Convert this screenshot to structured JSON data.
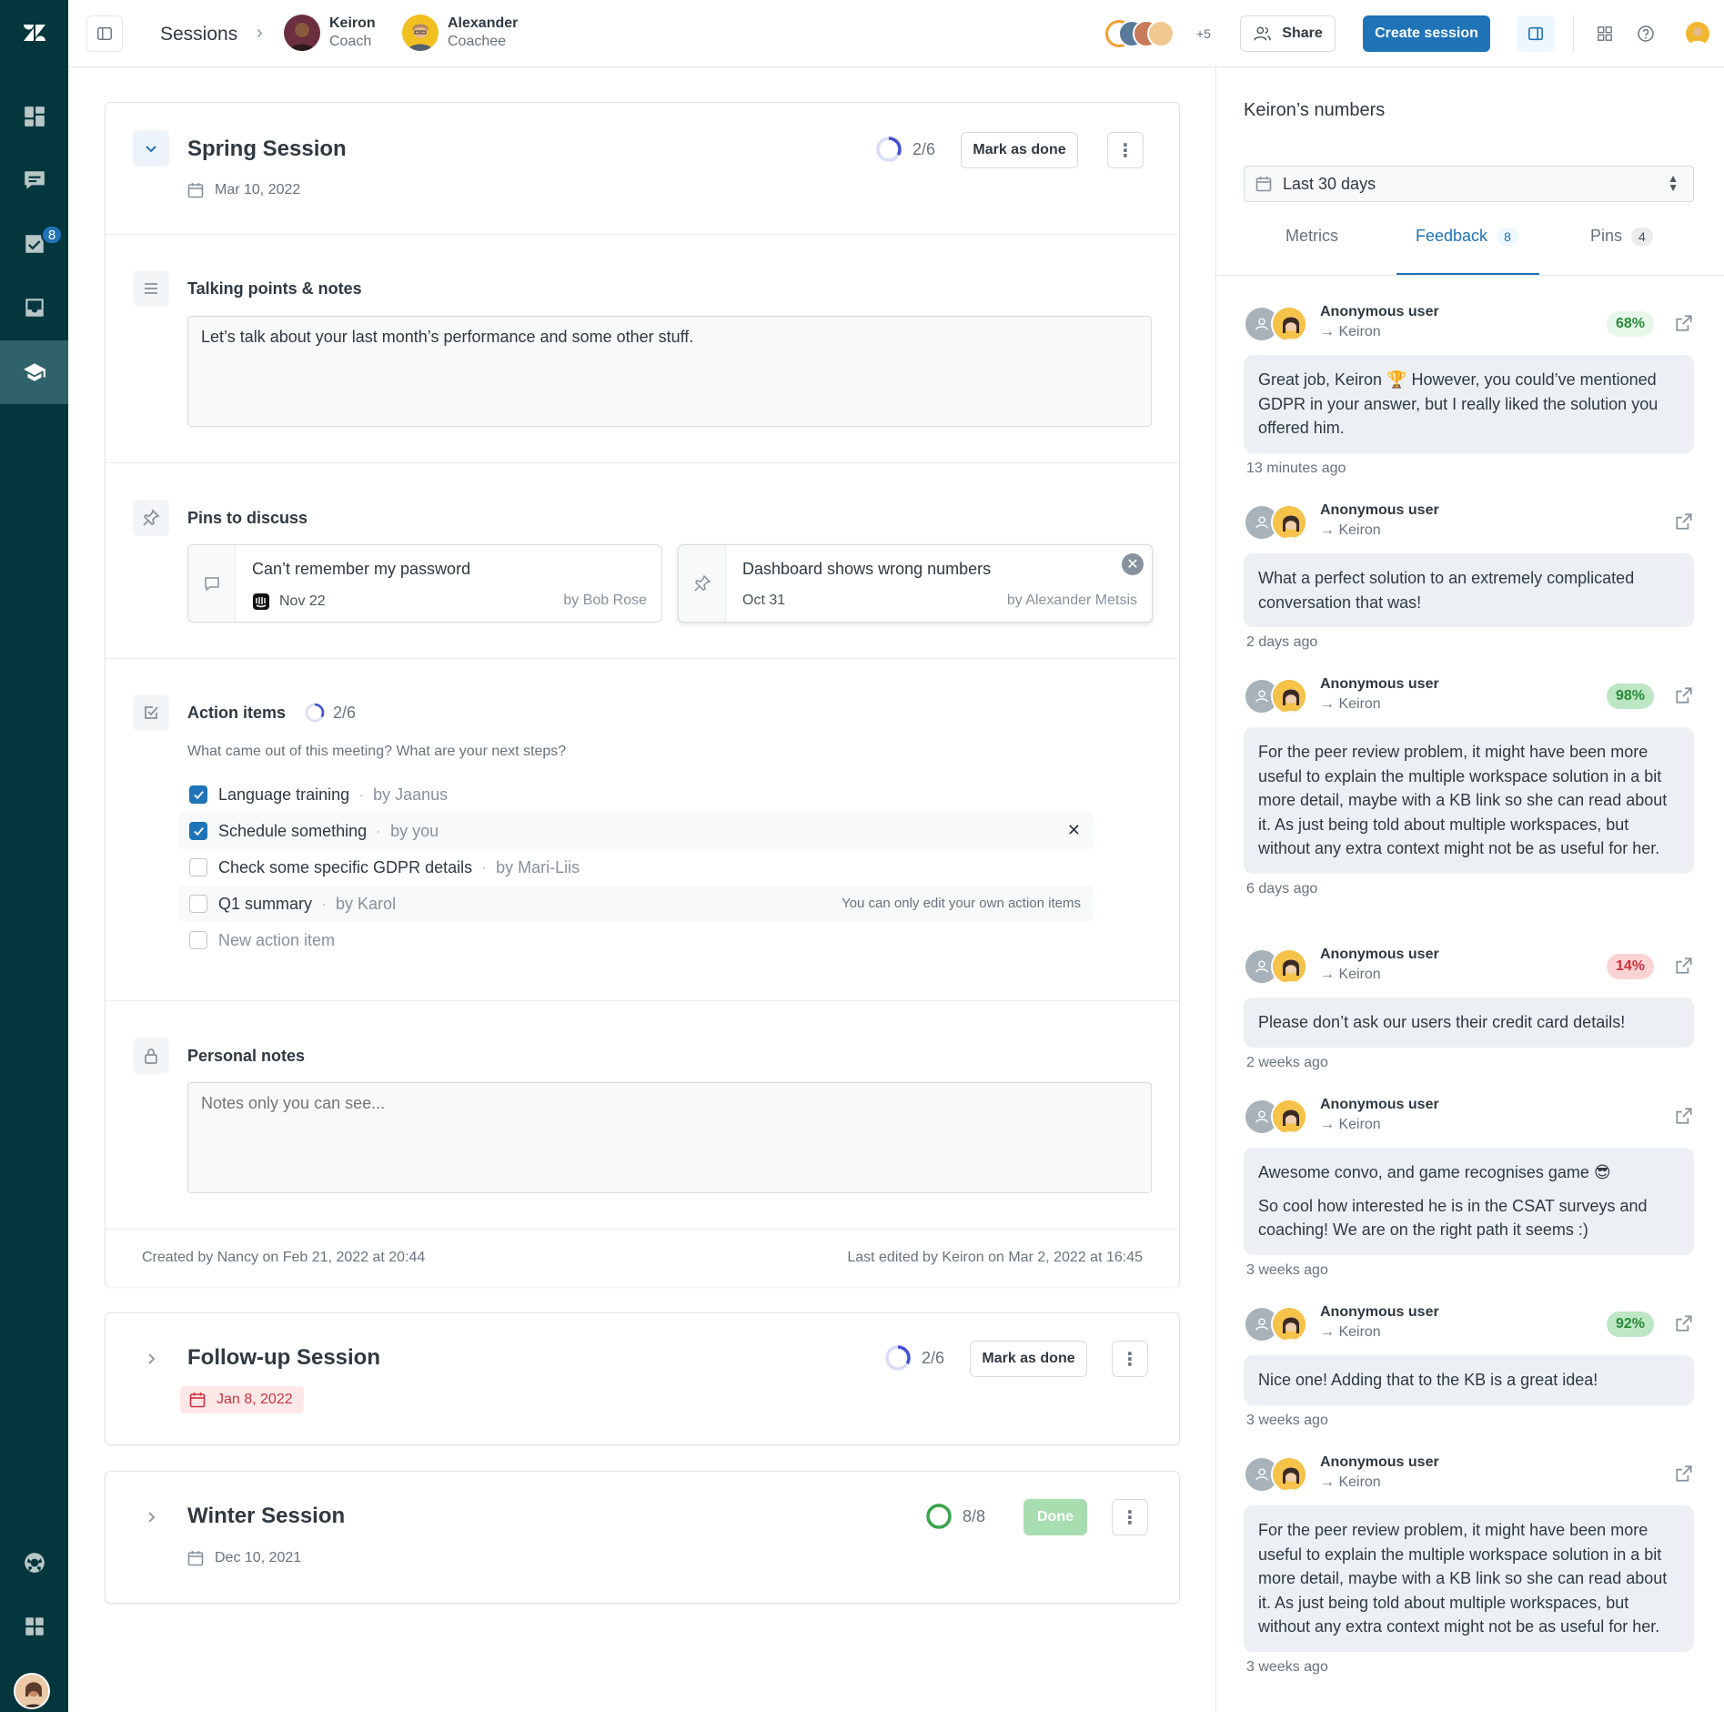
{
  "nav": {
    "tasks_badge": "8"
  },
  "header": {
    "breadcrumb": "Sessions",
    "coach": {
      "name": "Keiron",
      "role": "Coach"
    },
    "coachee": {
      "name": "Alexander",
      "role": "Coachee"
    },
    "participants_more": "+5",
    "share_label": "Share",
    "create_label": "Create session"
  },
  "sessions": {
    "spring": {
      "title": "Spring Session",
      "date": "Mar 10, 2022",
      "progress": "2/6",
      "progress_fraction": 0.333,
      "mark_done_label": "Mark as done",
      "talking_points_title": "Talking points & notes",
      "talking_points_text": "Let’s talk about your last month’s performance and some other stuff.",
      "pins_title": "Pins to discuss",
      "pins": [
        {
          "title": "Can’t remember my password",
          "date": "Nov 22",
          "by": "by Bob Rose"
        },
        {
          "title": "Dashboard shows wrong numbers",
          "date": "Oct 31",
          "by": "by Alexander Metsis"
        }
      ],
      "action_title": "Action items",
      "action_progress": "2/6",
      "action_hint": "What came out of this meeting? What are your next steps?",
      "actions": [
        {
          "text": "Language training",
          "by": "by Jaanus",
          "checked": true
        },
        {
          "text": "Schedule something",
          "by": "by you",
          "checked": true
        },
        {
          "text": "Check some specific GDPR details",
          "by": "by Mari-Liis",
          "checked": false
        },
        {
          "text": "Q1 summary",
          "by": "by Karol",
          "checked": false,
          "note": "You can only edit your own action items"
        }
      ],
      "new_action_placeholder": "New action item",
      "personal_title": "Personal notes",
      "personal_placeholder": "Notes only you can see...",
      "created": "Created by Nancy on Feb 21, 2022 at 20:44",
      "edited": "Last edited by Keiron on Mar 2, 2022 at 16:45"
    },
    "followup": {
      "title": "Follow-up Session",
      "date": "Jan 8, 2022",
      "progress": "2/6",
      "progress_fraction": 0.333,
      "mark_done_label": "Mark as done"
    },
    "winter": {
      "title": "Winter Session",
      "date": "Dec 10, 2021",
      "progress": "8/8",
      "progress_fraction": 1.0,
      "done_label": "Done"
    }
  },
  "panel": {
    "title": "Keiron’s numbers",
    "range": "Last 30 days",
    "tabs": [
      {
        "label": "Metrics",
        "count": ""
      },
      {
        "label": "Feedback",
        "count": "8"
      },
      {
        "label": "Pins",
        "count": "4"
      }
    ],
    "feedback": [
      {
        "user": "Anonymous user",
        "to": "→ Keiron",
        "score": "68%",
        "text": "Great job, Keiron 🏆 However, you could’ve mentioned GDPR in your answer, but I really liked the solution you offered him.",
        "time": "13 minutes ago"
      },
      {
        "user": "Anonymous user",
        "to": "→ Keiron",
        "score": "",
        "text": "What a perfect solution to an extremely complicated conversation that was!",
        "time": "2 days ago"
      },
      {
        "user": "Anonymous user",
        "to": "→ Keiron",
        "score": "98%",
        "text": "For the peer review problem, it might have been more useful to explain the multiple workspace solution in a bit more detail, maybe with a KB link so she can read about it. As just being told about multiple workspaces, but without any extra context might not be as useful for her.",
        "time": "6 days ago"
      },
      {
        "user": "Anonymous user",
        "to": "→ Keiron",
        "score": "14%",
        "text": "Please don’t ask our users their credit card details!",
        "time": "2 weeks ago"
      },
      {
        "user": "Anonymous user",
        "to": "→ Keiron",
        "score": "",
        "text": "Awesome convo, and game recognises game 😎",
        "text2": "So cool how interested he is in the CSAT surveys and coaching! We are on the right path it seems :)",
        "time": "3 weeks ago"
      },
      {
        "user": "Anonymous user",
        "to": "→ Keiron",
        "score": "92%",
        "text": "Nice one! Adding that to the KB is a great idea!",
        "time": "3 weeks ago"
      },
      {
        "user": "Anonymous user",
        "to": "→ Keiron",
        "score": "",
        "text": "For the peer review problem, it might have been more useful to explain the multiple workspace solution in a bit more detail, maybe with a KB link so she can read about it. As just being told about multiple workspaces, but without any extra context might not be as useful for her.",
        "time": "3 weeks ago"
      }
    ]
  },
  "colors": {
    "brand": "#03363d",
    "primary": "#1f73b7",
    "good": "#e6f6e9",
    "bad": "#fde5e5",
    "done": "#a8ddb0"
  }
}
